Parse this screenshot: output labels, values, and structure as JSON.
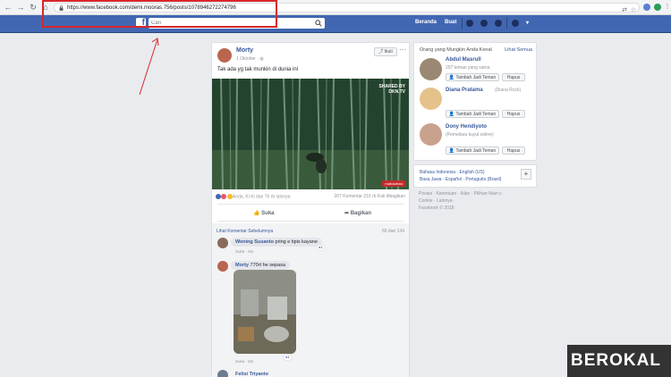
{
  "browser": {
    "url": "https://www.facebook.com/demi.mooras.756/posts/1078946272274796"
  },
  "fbbar": {
    "logo": "f",
    "search_placeholder": "Cari",
    "home_label": "Beranda",
    "find_friends_label": "Buat"
  },
  "post": {
    "author": "Morty",
    "date": "1 Oktober · ",
    "follow_label": "Ikuti",
    "more": "···",
    "text": "Tak ada yg tak munkin di dunia ini",
    "watermark_top": "SHARED BY\nDKN.TV",
    "watermark_bottom": "mahadewa",
    "reactions_text": "Anda, Ki Ki dan 76 rb lainnya",
    "stats_text": "207 Komentar  215 rb Kali dibagikan",
    "like_label": "Suka",
    "share_label": "Bagikan"
  },
  "comments": {
    "prev_link": "Lihat Komentar Sebelumnya",
    "count": "50 dari 134",
    "items": [
      {
        "name": "Wening Susanto",
        "text": "pring e tipis kayane",
        "meta": "Suka · 5m",
        "likes": "1"
      },
      {
        "name": "Morty",
        "text": "770rt he sepasa",
        "meta": "Suka · 5m",
        "likes": "1"
      },
      {
        "name": "Felisi Triyanto",
        "text": "",
        "meta": "",
        "likes": ""
      }
    ]
  },
  "pymk": {
    "title": "Orang yang Mungkin Anda Kenal",
    "see_all": "Lihat Semua",
    "add_label": "Tambah Jadi Teman",
    "remove_label": "Hapus",
    "people": [
      {
        "name": "Abdul Masrull",
        "sub": "297 teman yang sama"
      },
      {
        "name": "Diana Pratama",
        "sub": "(Diana Rock)"
      },
      {
        "name": "Dony Hendiyoto",
        "sub": "(Pemeliara kuyul online)"
      }
    ]
  },
  "languages": {
    "line1": "Bahasa Indonesia · English (US)",
    "line2": "Basa Jawa · Español · Português (Brasil)",
    "plus": "+"
  },
  "footer": {
    "line1": "Privasi · Ketentuan · Iklan · Pilihan Iklan ▷",
    "line2": "Cookie · Lainnya ·",
    "line3": "Facebook © 2018"
  },
  "brand": "BEROKAL",
  "colors": {
    "fb_blue": "#4267b2",
    "annotation_red": "#d9262b"
  }
}
